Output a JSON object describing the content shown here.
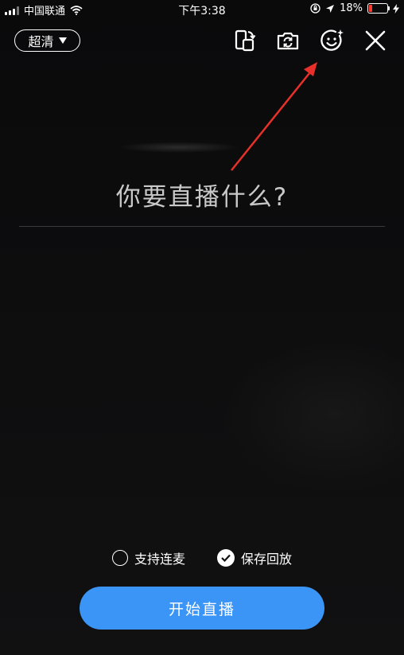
{
  "status_bar": {
    "carrier": "中国联通",
    "time": "下午3:38",
    "battery_percent": "18%",
    "battery_level": 0.18,
    "battery_color": "#ff3b30"
  },
  "top_bar": {
    "quality_label": "超清",
    "icons": [
      "rotate-screen-icon",
      "flip-camera-icon",
      "beauty-face-icon",
      "close-icon"
    ]
  },
  "main": {
    "prompt": "你要直播什么?"
  },
  "options": {
    "co_host_label": "支持连麦",
    "co_host_checked": false,
    "save_replay_label": "保存回放",
    "save_replay_checked": true
  },
  "start_button": {
    "label": "开始直播",
    "color": "#3a95f6"
  },
  "annotation": {
    "arrow_color": "#e8302a"
  }
}
